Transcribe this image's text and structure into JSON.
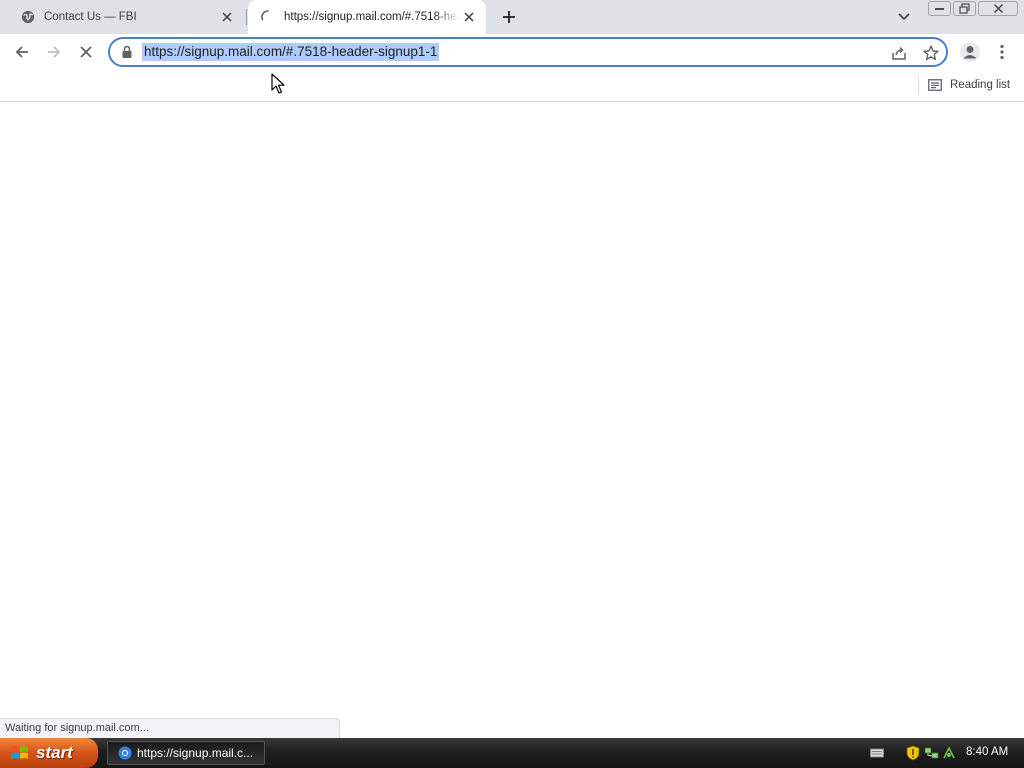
{
  "tabs": [
    {
      "title": "Contact Us — FBI",
      "favicon": "globe-icon",
      "active": false
    },
    {
      "title": "https://signup.mail.com/#.7518-header-signup1-1",
      "favicon": "loading-spinner-icon",
      "active": true
    }
  ],
  "toolbar": {
    "url": "https://signup.mail.com/#.7518-header-signup1-1",
    "url_selected": true
  },
  "bookmarks_bar": {
    "reading_list_label": "Reading list"
  },
  "status": {
    "text": "Waiting for signup.mail.com..."
  },
  "taskbar": {
    "start_label": "start",
    "task_label": "https://signup.mail.c...",
    "clock": "8:40 AM"
  },
  "colors": {
    "tabstrip": "#dee1e6",
    "focus_ring": "#4a7fcf",
    "url_selection": "#aecbfa",
    "start_button": "#d4531a"
  }
}
